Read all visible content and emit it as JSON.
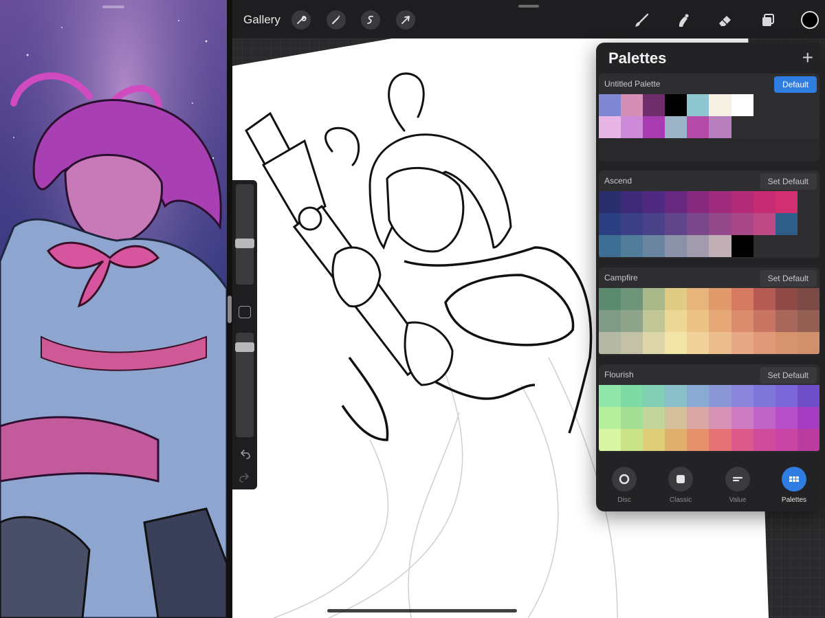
{
  "toolbar": {
    "gallery_label": "Gallery",
    "left_tools": [
      "wrench-icon",
      "magic-wand-icon",
      "selection-icon",
      "transform-arrow-icon"
    ],
    "right_tools": [
      "brush-icon",
      "smudge-icon",
      "eraser-icon",
      "layers-icon"
    ],
    "current_color": "#000000"
  },
  "palettes": {
    "title": "Palettes",
    "add_label": "+",
    "items": [
      {
        "name": "Untitled Palette",
        "default_label": "Default",
        "is_default": true,
        "colors": [
          "#7f87d3",
          "#d38fb6",
          "#6e2c6a",
          "#000000",
          "#8ec7cf",
          "#f6f1e3",
          "#ffffff",
          "#e7b6e7",
          "#cf89d9",
          "#a93bb1",
          "#9cb3c8",
          "#b54aa9",
          "#b77fbd"
        ]
      },
      {
        "name": "Ascend",
        "default_label": "Set Default",
        "is_default": false,
        "colors": [
          "#2b2e6d",
          "#3d2b78",
          "#4e2a80",
          "#66297f",
          "#872a7e",
          "#9e2b7b",
          "#b42b77",
          "#c62c74",
          "#d12f70",
          "#2d3f83",
          "#3c3f86",
          "#4a4289",
          "#60458a",
          "#7a478a",
          "#93488a",
          "#a94888",
          "#be4a85",
          "#2f5d8a",
          "#3d6d93",
          "#527d9a",
          "#6a85a0",
          "#8b91a6",
          "#a29aad",
          "#c2aeb5",
          "#000000"
        ]
      },
      {
        "name": "Campfire",
        "default_label": "Set Default",
        "is_default": false,
        "colors": [
          "#5c8a6f",
          "#6e9579",
          "#a9b98a",
          "#e1cc86",
          "#e7b57b",
          "#e09a6c",
          "#d57961",
          "#b45a52",
          "#8f4a45",
          "#7b4a44",
          "#7f9b86",
          "#8ea58c",
          "#c1c697",
          "#ecd796",
          "#ecc184",
          "#e5a876",
          "#db8c6c",
          "#c87663",
          "#a8655a",
          "#946054",
          "#b5b8a3",
          "#c3c2a6",
          "#dcd6a8",
          "#f2e3a7",
          "#f2d29b",
          "#ebbd8c",
          "#e7a985",
          "#e09a79",
          "#d6946f",
          "#cf906b"
        ]
      },
      {
        "name": "Flourish",
        "default_label": "Set Default",
        "is_default": false,
        "colors": [
          "#8fe6a8",
          "#7fdba6",
          "#83cfb6",
          "#8bbfc9",
          "#8aaad4",
          "#8b97d6",
          "#8a85da",
          "#7f75d8",
          "#7b68d8",
          "#6e4fc7",
          "#b5ee9c",
          "#a4dd94",
          "#c3d49c",
          "#d4c09c",
          "#dba6a6",
          "#d793b6",
          "#cd7cc4",
          "#c165c8",
          "#b650c8",
          "#a53ec2",
          "#d8f5a4",
          "#c9e386",
          "#dece79",
          "#e1af6d",
          "#e6906b",
          "#e47276",
          "#dc5a8a",
          "#d14c9a",
          "#c845a4",
          "#ba3d9f"
        ]
      }
    ]
  },
  "tabs": [
    {
      "label": "Disc",
      "icon": "disc-icon",
      "active": false
    },
    {
      "label": "Classic",
      "icon": "classic-square-icon",
      "active": false
    },
    {
      "label": "Value",
      "icon": "value-sliders-icon",
      "active": false
    },
    {
      "label": "Palettes",
      "icon": "palettes-grid-icon",
      "active": true
    }
  ],
  "sidebar": {
    "brush_size_level": 0.4,
    "opacity_level": 0.9
  }
}
